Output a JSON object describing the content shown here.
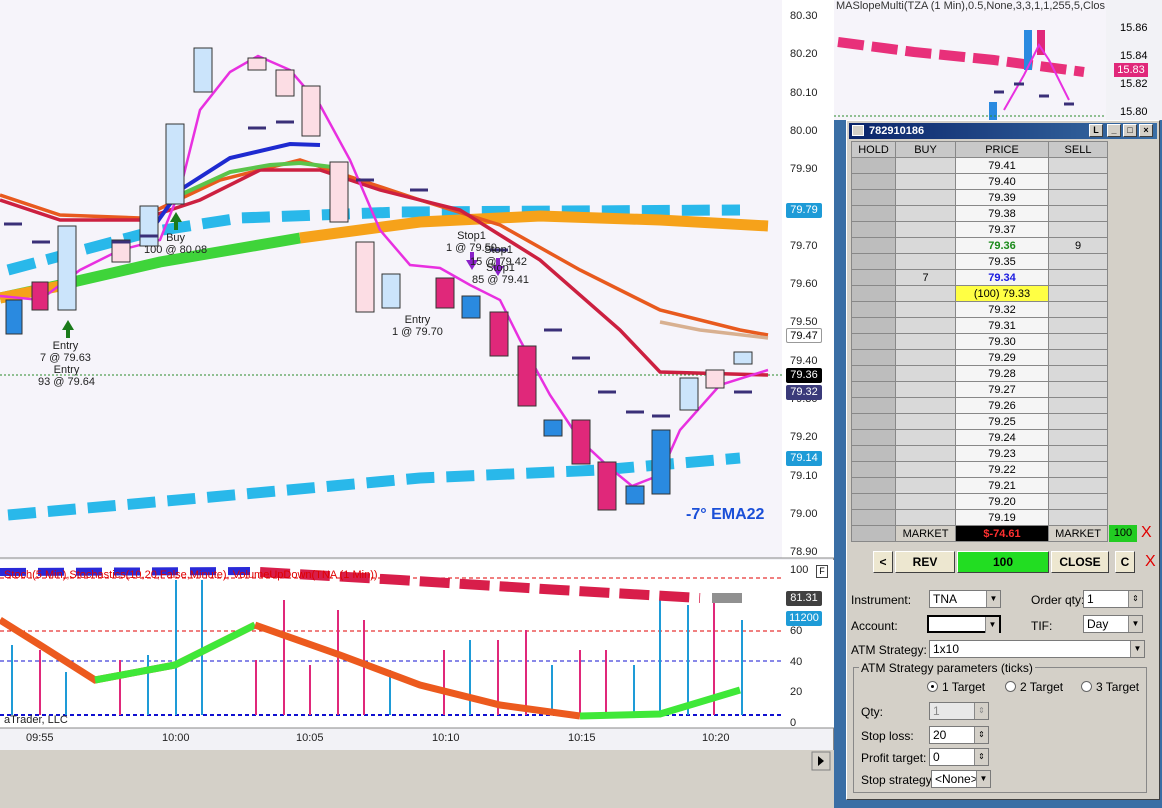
{
  "main_chart": {
    "price_axis": [
      "80.30",
      "80.20",
      "80.10",
      "80.00",
      "79.90",
      "79.80",
      "79.70",
      "79.60",
      "79.50",
      "79.40",
      "79.30",
      "79.20",
      "79.10",
      "79.00",
      "78.90"
    ],
    "price_tags": [
      {
        "value": "79.79",
        "color": "#1e9bd7"
      },
      {
        "value": "79.47",
        "color": "#d8d8d8"
      },
      {
        "value": "79.36",
        "color": "#000000"
      },
      {
        "value": "79.32",
        "color": "#3a3a7a"
      },
      {
        "value": "79.14",
        "color": "#1e9bd7"
      }
    ],
    "time_axis": [
      "09:55",
      "10:00",
      "10:05",
      "10:10",
      "10:15",
      "10:20"
    ],
    "ema_label": "-7° EMA22",
    "annotations": [
      {
        "text": "Buy\n100 @ 80.08"
      },
      {
        "text": "Entry\n7 @ 79.63"
      },
      {
        "text": "Entry\n93 @ 79.64"
      },
      {
        "text": "Entry\n1 @ 79.70"
      },
      {
        "text": "Stop1\n1 @ 79.50"
      },
      {
        "text": "Stop1\n15 @ 79.42"
      },
      {
        "text": "Stop1\n85 @ 79.41"
      }
    ],
    "indicator_title": "Stoch(5 Min),Stochastics(10,20,False,Minute), VolumeUpDown(TNA (1 Min))",
    "indicator_axis": [
      "100",
      "80",
      "60",
      "40",
      "20",
      "0"
    ],
    "indicator_tags": [
      {
        "value": "81.31",
        "color": "#404040"
      },
      {
        "value": "11200",
        "color": "#1e9bd7"
      }
    ],
    "copyright": "aTrader, LLC",
    "f_button": "F"
  },
  "mini_chart": {
    "title": "MASlopeMulti(TZA (1 Min),0.5,None,3,3,1,1,255,5,Clos",
    "axis": [
      "15.86",
      "15.84",
      "15.82",
      "15.80"
    ],
    "tag": {
      "value": "15.83",
      "color": "#e0287a"
    }
  },
  "dom": {
    "title": "782910186",
    "headers": {
      "hold": "HOLD",
      "buy": "BUY",
      "price": "PRICE",
      "sell": "SELL"
    },
    "rows": [
      {
        "price": "79.41",
        "buy": "",
        "sell": "",
        "style": ""
      },
      {
        "price": "79.40",
        "buy": "",
        "sell": "",
        "style": ""
      },
      {
        "price": "79.39",
        "buy": "",
        "sell": "",
        "style": ""
      },
      {
        "price": "79.38",
        "buy": "",
        "sell": "",
        "style": ""
      },
      {
        "price": "79.37",
        "buy": "",
        "sell": "",
        "style": ""
      },
      {
        "price": "79.36",
        "buy": "",
        "sell": "9",
        "style": "last"
      },
      {
        "price": "79.35",
        "buy": "",
        "sell": "",
        "style": ""
      },
      {
        "price": "79.34",
        "buy": "7",
        "sell": "",
        "style": "bid"
      },
      {
        "price": "(100) 79.33",
        "buy": "",
        "sell": "",
        "style": "position"
      },
      {
        "price": "79.32",
        "buy": "",
        "sell": "",
        "style": ""
      },
      {
        "price": "79.31",
        "buy": "",
        "sell": "",
        "style": ""
      },
      {
        "price": "79.30",
        "buy": "",
        "sell": "",
        "style": ""
      },
      {
        "price": "79.29",
        "buy": "",
        "sell": "",
        "style": ""
      },
      {
        "price": "79.28",
        "buy": "",
        "sell": "",
        "style": ""
      },
      {
        "price": "79.27",
        "buy": "",
        "sell": "",
        "style": ""
      },
      {
        "price": "79.26",
        "buy": "",
        "sell": "",
        "style": ""
      },
      {
        "price": "79.25",
        "buy": "",
        "sell": "",
        "style": ""
      },
      {
        "price": "79.24",
        "buy": "",
        "sell": "",
        "style": ""
      },
      {
        "price": "79.23",
        "buy": "",
        "sell": "",
        "style": ""
      },
      {
        "price": "79.22",
        "buy": "",
        "sell": "",
        "style": ""
      },
      {
        "price": "79.21",
        "buy": "",
        "sell": "",
        "style": ""
      },
      {
        "price": "79.20",
        "buy": "",
        "sell": "",
        "style": ""
      },
      {
        "price": "79.19",
        "buy": "",
        "sell": "",
        "style": ""
      }
    ],
    "footer": {
      "market_buy": "MARKET",
      "pnl": "$-74.61",
      "market_sell": "MARKET",
      "qty": "100"
    },
    "controls": {
      "left": "<",
      "rev": "REV",
      "position": "100",
      "close": "CLOSE",
      "c": "C",
      "x": "X"
    },
    "form": {
      "instrument_label": "Instrument:",
      "instrument": "TNA",
      "order_qty_label": "Order qty:",
      "order_qty": "1",
      "account_label": "Account:",
      "account": "",
      "tif_label": "TIF:",
      "tif": "Day",
      "atm_label": "ATM Strategy:",
      "atm": "1x10",
      "params_title": "ATM Strategy parameters (ticks)",
      "targets": [
        "1 Target",
        "2 Target",
        "3 Target"
      ],
      "qty_label": "Qty:",
      "qty": "1",
      "stop_loss_label": "Stop loss:",
      "stop_loss": "20",
      "profit_target_label": "Profit target:",
      "profit_target": "0",
      "stop_strategy_label": "Stop strategy:",
      "stop_strategy": "<None>"
    }
  }
}
